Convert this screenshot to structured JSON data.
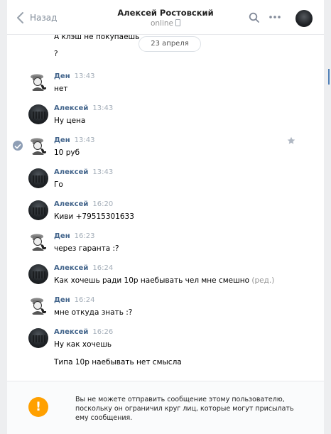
{
  "header": {
    "back_label": "Назад",
    "title": "Алексей Ростовский",
    "status": "online"
  },
  "date_divider": "23 апреля",
  "previous": {
    "line1": "А клэш не покупаешь",
    "line2": "?"
  },
  "messages": [
    {
      "author": "Ден",
      "time": "13:43",
      "text": "нет",
      "avatar": "holmes"
    },
    {
      "author": "Алексей",
      "time": "13:43",
      "text": "Ну цена",
      "avatar": "dark"
    },
    {
      "author": "Ден",
      "time": "13:43",
      "text": "10 руб",
      "avatar": "holmes",
      "selected": true
    },
    {
      "author": "Алексей",
      "time": "13:43",
      "text": "Го",
      "avatar": "dark"
    },
    {
      "author": "Алексей",
      "time": "16:20",
      "text": "Киви +79515301633",
      "avatar": "dark"
    },
    {
      "author": "Ден",
      "time": "16:23",
      "text": "через гаранта :?",
      "avatar": "holmes"
    },
    {
      "author": "Алексей",
      "time": "16:24",
      "text": "Как хочешь ради 10р наебывать чел мне смешно",
      "edited": "(ред.)",
      "avatar": "dark"
    },
    {
      "author": "Ден",
      "time": "16:24",
      "text": "мне откуда знать :?",
      "avatar": "holmes"
    },
    {
      "author": "Алексей",
      "time": "16:26",
      "text": "Ну как хочешь",
      "text2": "Типа 10р наебывать нет смысла",
      "avatar": "dark"
    }
  ],
  "notice": {
    "text": "Вы не можете отправить сообщение этому пользователю, поскольку он ограничил круг лиц, которые могут присылать ему сообщения.",
    "icon": "!"
  },
  "colors": {
    "author": "#42648b",
    "accent": "#5181b8",
    "warning": "#ffa000"
  }
}
